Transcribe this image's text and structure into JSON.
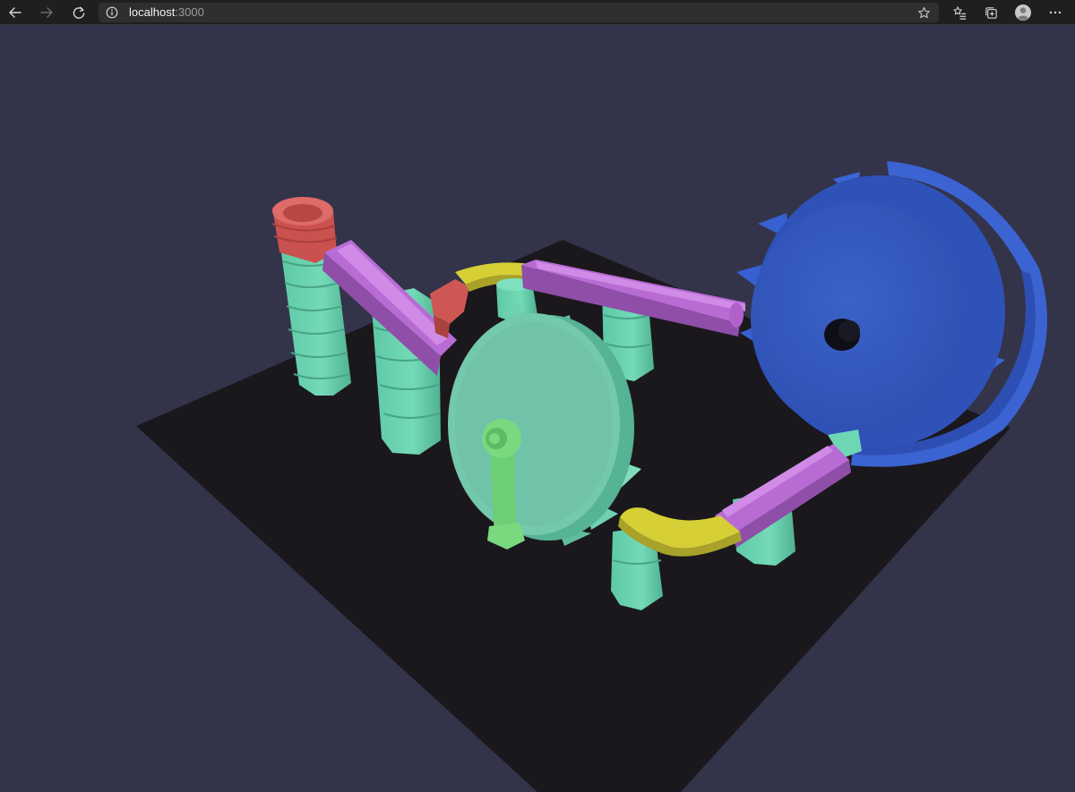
{
  "browser": {
    "url_host": "localhost",
    "url_port": ":3000",
    "icons": {
      "back": "back-arrow-icon",
      "forward": "forward-arrow-icon",
      "reload": "reload-icon",
      "info": "info-icon",
      "favorite": "star-icon",
      "favorites_list": "favorites-list-icon",
      "collections": "collections-icon",
      "profile": "profile-avatar-icon",
      "more": "more-menu-icon"
    }
  },
  "scene": {
    "background_color": "#33334a",
    "floor_color": "#1a181c",
    "colors": {
      "teal": "#6fd6b4",
      "purple": "#b56ad1",
      "yellow": "#d8d23a",
      "red": "#d4605c",
      "blue": "#3a62cf",
      "green": "#7ad97f"
    }
  }
}
